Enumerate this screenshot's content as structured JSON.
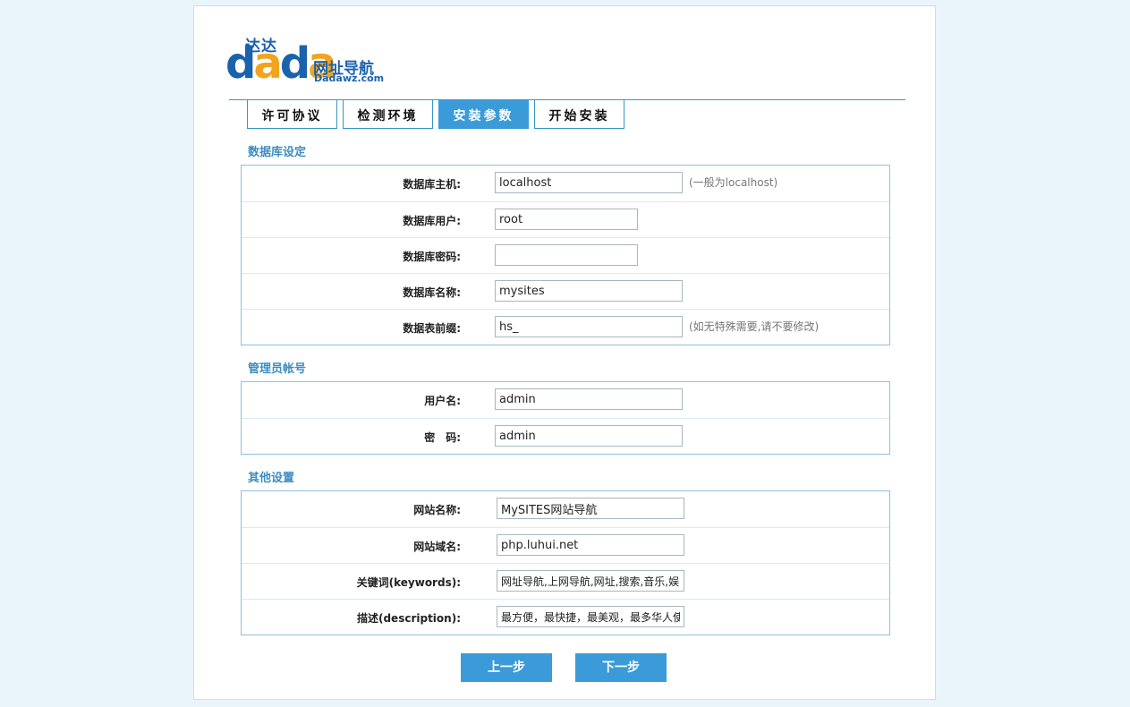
{
  "logo": {
    "big_blue1": "d",
    "big_orange1": "a",
    "big_blue2": "d",
    "big_orange2": "a",
    "cn_top": "达达",
    "cn_side": "网址导航",
    "en": "Dadawz.com"
  },
  "tabs": [
    {
      "label": "许可协议",
      "active": false
    },
    {
      "label": "检测环境",
      "active": false
    },
    {
      "label": "安装参数",
      "active": true
    },
    {
      "label": "开始安装",
      "active": false
    }
  ],
  "sections": {
    "database": {
      "title": "数据库设定",
      "rows": [
        {
          "label": "数据库主机:",
          "value": "localhost",
          "hint": "(一般为localhost)"
        },
        {
          "label": "数据库用户:",
          "value": "root",
          "hint": ""
        },
        {
          "label": "数据库密码:",
          "value": "",
          "hint": ""
        },
        {
          "label": "数据库名称:",
          "value": "mysites",
          "hint": ""
        },
        {
          "label": "数据表前缀:",
          "value": "hs_",
          "hint": "(如无特殊需要,请不要修改)"
        }
      ]
    },
    "admin": {
      "title": "管理员帐号",
      "rows": [
        {
          "label": "用户名:",
          "value": "admin"
        },
        {
          "label": "密　码:",
          "value": "admin"
        }
      ]
    },
    "other": {
      "title": "其他设置",
      "rows": [
        {
          "label": "网站名称:",
          "value": "MySITES网站导航"
        },
        {
          "label": "网站域名:",
          "value": "php.luhui.net"
        },
        {
          "label": "关键词(keywords):",
          "value": "网址导航,上网导航,网址,搜索,音乐,娱"
        },
        {
          "label": "描述(description):",
          "value": "最方便，最快捷，最美观，最多华人使"
        }
      ]
    }
  },
  "buttons": {
    "prev": "上一步",
    "next": "下一步"
  }
}
